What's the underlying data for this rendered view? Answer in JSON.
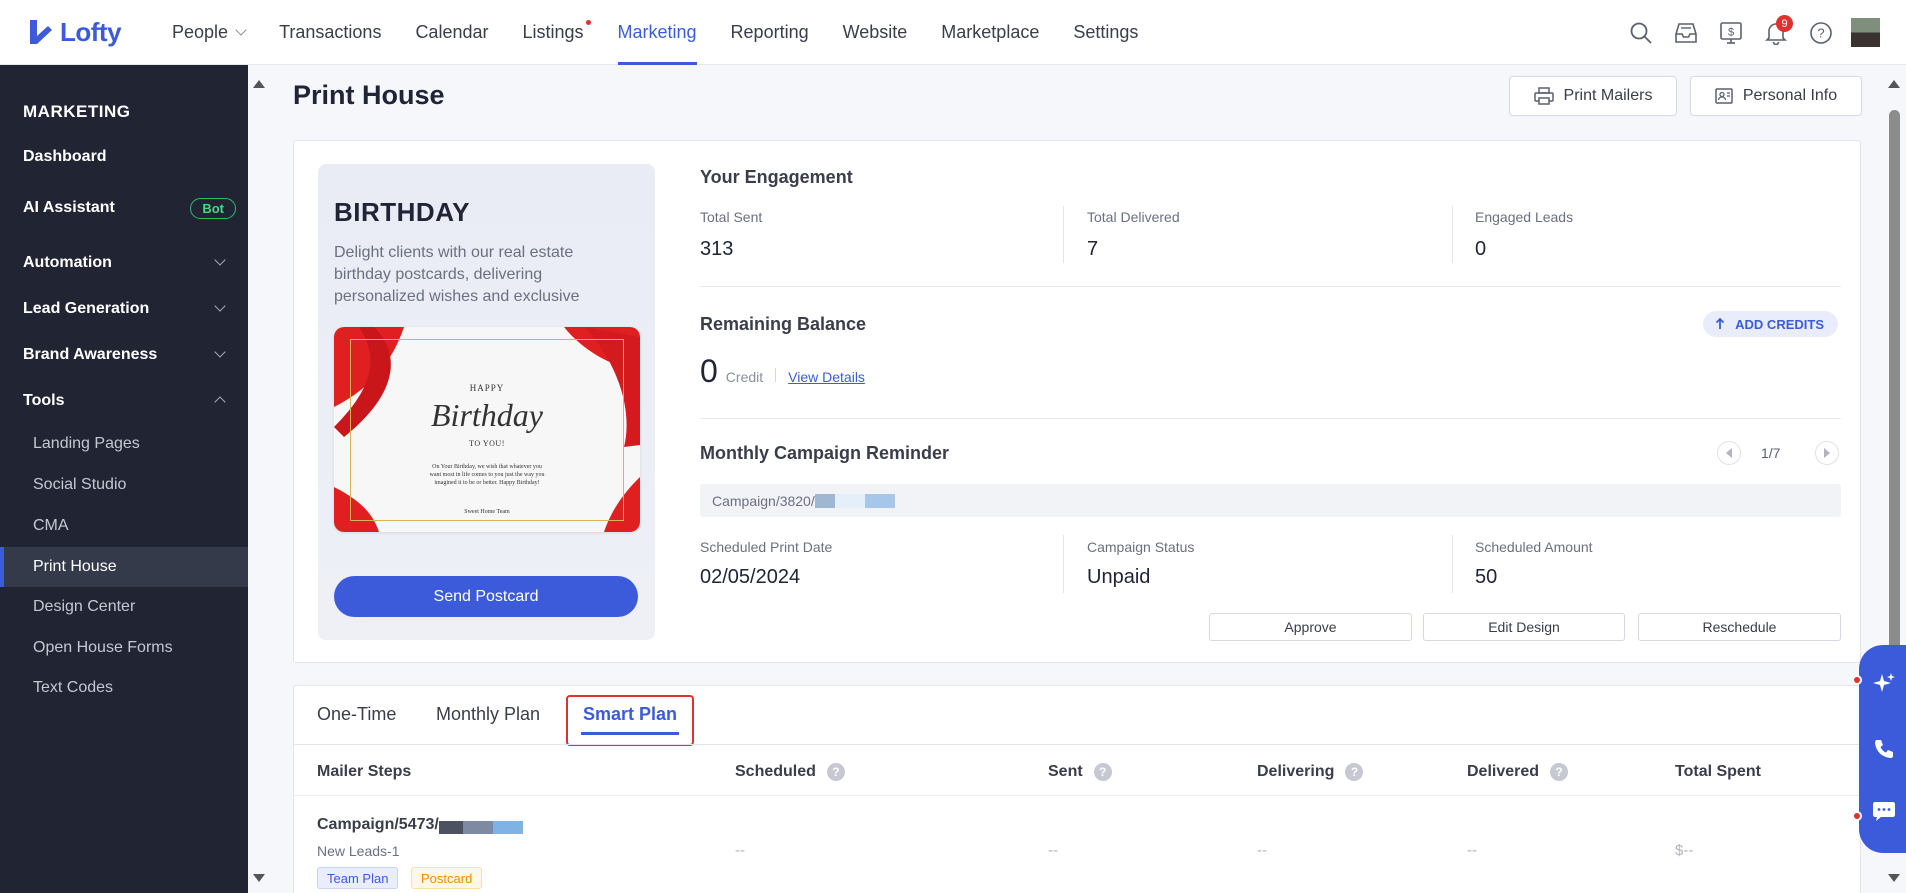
{
  "brand": {
    "name": "Lofty",
    "color": "#3b5bdb"
  },
  "nav": {
    "items": [
      {
        "label": "People",
        "has_dropdown": true
      },
      {
        "label": "Transactions"
      },
      {
        "label": "Calendar"
      },
      {
        "label": "Listings",
        "has_dot": true
      },
      {
        "label": "Marketing",
        "active": true
      },
      {
        "label": "Reporting"
      },
      {
        "label": "Website"
      },
      {
        "label": "Marketplace"
      },
      {
        "label": "Settings"
      }
    ],
    "icons": [
      "search-icon",
      "inbox-icon",
      "billing-icon",
      "bell-icon",
      "help-icon"
    ],
    "notification_count": "9"
  },
  "sidebar": {
    "heading": "MARKETING",
    "items": [
      {
        "label": "Dashboard"
      },
      {
        "label": "AI Assistant",
        "badge": "Bot"
      },
      {
        "label": "Automation",
        "expandable": true
      },
      {
        "label": "Lead Generation",
        "expandable": true
      },
      {
        "label": "Brand Awareness",
        "expandable": true
      },
      {
        "label": "Tools",
        "expanded": true
      }
    ],
    "tools": [
      {
        "label": "Landing Pages"
      },
      {
        "label": "Social Studio"
      },
      {
        "label": "CMA"
      },
      {
        "label": "Print House",
        "active": true
      },
      {
        "label": "Design Center"
      },
      {
        "label": "Open House Forms"
      },
      {
        "label": "Text Codes"
      }
    ]
  },
  "page": {
    "title": "Print House",
    "print_mailers_label": "Print Mailers",
    "personal_info_label": "Personal Info"
  },
  "promo": {
    "title": "BIRTHDAY",
    "description": "Delight clients with our real estate birthday postcards, delivering personalized wishes and exclusive",
    "postcard": {
      "happy": "HAPPY",
      "birthday": "Birthday",
      "to_you": "TO YOU!",
      "message": "On Your Birthday, we wish that whatever you want most in life comes to you just the way you imagined it to be or better. Happy Birthday!",
      "signoff": "Sweet Home Team"
    },
    "send_label": "Send Postcard"
  },
  "engagement": {
    "title": "Your Engagement",
    "stats": [
      {
        "label": "Total Sent",
        "value": "313"
      },
      {
        "label": "Total Delivered",
        "value": "7"
      },
      {
        "label": "Engaged Leads",
        "value": "0"
      }
    ]
  },
  "balance": {
    "title": "Remaining Balance",
    "add_credits_label": "ADD CREDITS",
    "amount": "0",
    "unit": "Credit",
    "view_details_label": "View Details"
  },
  "reminder": {
    "title": "Monthly Campaign Reminder",
    "pager": "1/7",
    "campaign_name": "Campaign/3820/",
    "fields": [
      {
        "label": "Scheduled Print Date",
        "value": "02/05/2024"
      },
      {
        "label": "Campaign Status",
        "value": "Unpaid"
      },
      {
        "label": "Scheduled Amount",
        "value": "50"
      }
    ],
    "actions": [
      "Approve",
      "Edit Design",
      "Reschedule"
    ]
  },
  "plans": {
    "tabs": [
      {
        "label": "One-Time"
      },
      {
        "label": "Monthly Plan"
      },
      {
        "label": "Smart Plan",
        "active": true
      }
    ],
    "columns": [
      {
        "label": "Mailer Steps"
      },
      {
        "label": "Scheduled",
        "help": true
      },
      {
        "label": "Sent",
        "help": true
      },
      {
        "label": "Delivering",
        "help": true
      },
      {
        "label": "Delivered",
        "help": true
      },
      {
        "label": "Total Spent"
      }
    ],
    "rows": [
      {
        "name": "Campaign/5473/",
        "subtitle": "New Leads-1",
        "tags": [
          "Team Plan",
          "Postcard"
        ],
        "scheduled": "--",
        "sent": "--",
        "delivering": "--",
        "delivered": "--",
        "total_spent": "$--"
      }
    ]
  }
}
